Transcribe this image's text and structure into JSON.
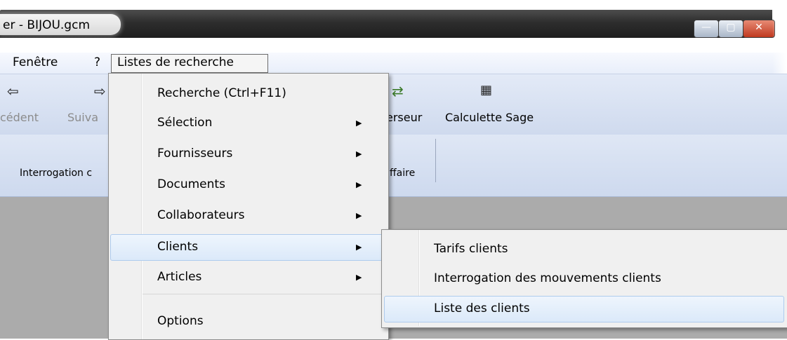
{
  "window": {
    "title": "er - BIJOU.gcm",
    "close_glyph": "✕",
    "minimize_glyph": "—",
    "maximize_glyph": "▢"
  },
  "menubar": {
    "items": [
      {
        "label": "Fenêtre"
      },
      {
        "label": "?"
      },
      {
        "label": "Listes de recherche",
        "active": true
      }
    ]
  },
  "toolbar": {
    "buttons": [
      {
        "label": "cédent",
        "icon": "arrow-left-icon",
        "glyph": "⇦",
        "disabled": true
      },
      {
        "label": "Suiva",
        "icon": "arrow-right-icon",
        "glyph": "⇨",
        "disabled": true
      },
      {
        "label": "erseur",
        "icon": "transfer-icon",
        "glyph": "⇄",
        "disabled": false
      },
      {
        "label": "Calculette Sage",
        "icon": "calculator-icon",
        "glyph": "▦",
        "disabled": false
      }
    ]
  },
  "ribbon": {
    "items": [
      {
        "label": "Interrogation c"
      },
      {
        "label": "ffaire"
      }
    ]
  },
  "dropdown": {
    "items": [
      {
        "label": "Recherche (Ctrl+F11)",
        "submenu": false
      },
      {
        "label": "Sélection",
        "submenu": true
      },
      {
        "label": "Fournisseurs",
        "submenu": true
      },
      {
        "label": "Documents",
        "submenu": true
      },
      {
        "label": "Collaborateurs",
        "submenu": true
      },
      {
        "label": "Clients",
        "submenu": true,
        "highlighted": true
      },
      {
        "label": "Articles",
        "submenu": true
      },
      {
        "label": "Options",
        "submenu": false
      }
    ],
    "arrow_glyph": "▶"
  },
  "submenu": {
    "items": [
      {
        "label": "Tarifs clients"
      },
      {
        "label": "Interrogation des mouvements clients"
      },
      {
        "label": "Liste des clients",
        "highlighted": true
      }
    ]
  },
  "colors": {
    "highlight_border": "#aecbed",
    "workspace": "#ababab",
    "menu_bg": "#f0f0f0"
  }
}
